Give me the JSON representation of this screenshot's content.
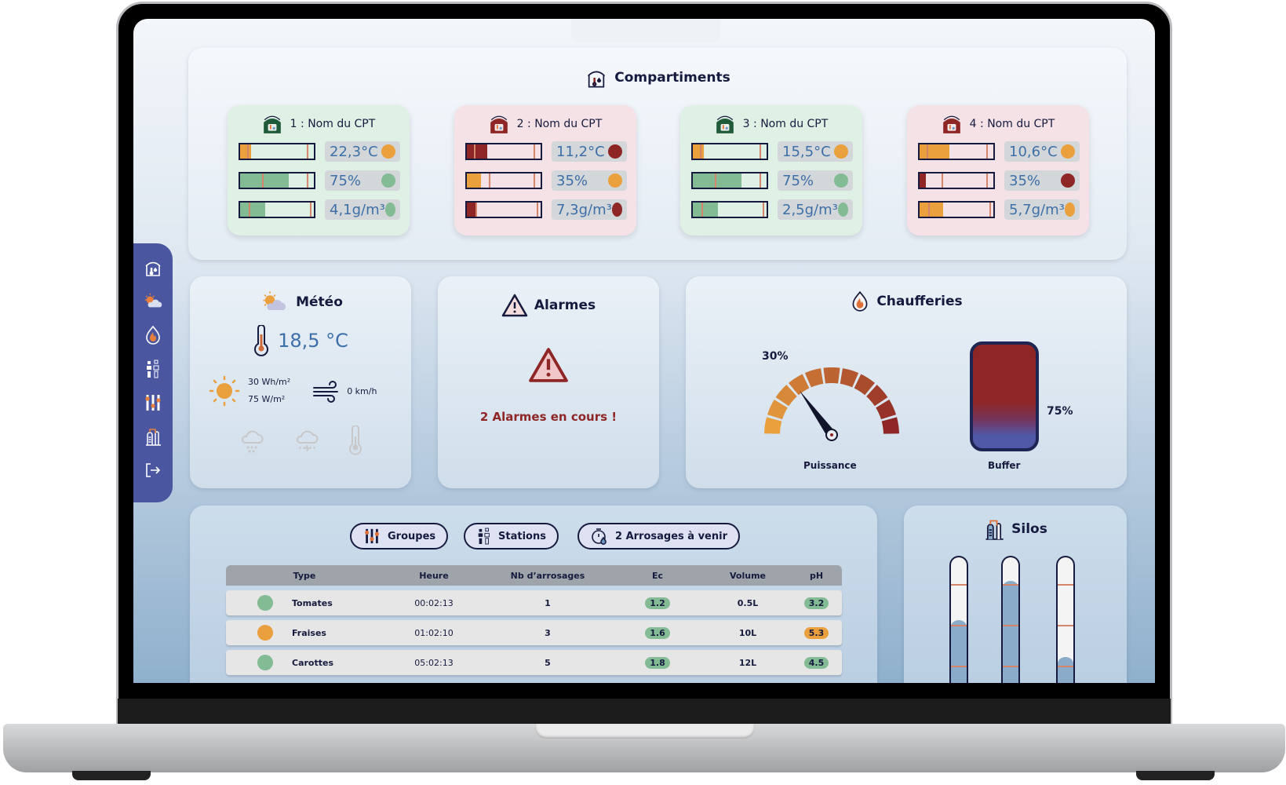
{
  "sidebar": {
    "items": [
      {
        "icon": "greenhouse-icon",
        "label": "Compartiments"
      },
      {
        "icon": "weather-icon",
        "label": "Météo"
      },
      {
        "icon": "flame-icon",
        "label": "Chaufferies"
      },
      {
        "icon": "stations-icon",
        "label": "Stations"
      },
      {
        "icon": "sliders-icon",
        "label": "Groupes"
      },
      {
        "icon": "silo-icon",
        "label": "Silos"
      },
      {
        "icon": "logout-icon",
        "label": "Déconnexion"
      }
    ]
  },
  "compartments": {
    "title": "Compartiments",
    "items": [
      {
        "name": "1 : Nom du CPT",
        "status": "ok",
        "metrics": [
          {
            "value": "22,3°C",
            "fill": 0.15,
            "fill_color": "#e9a03d",
            "status_color": "#e9a03d"
          },
          {
            "value": "75%",
            "fill": 0.66,
            "fill_color": "#82bb94",
            "status_color": "#82bb94"
          },
          {
            "value": "4,1g/m³",
            "fill": 0.34,
            "fill_color": "#82bb94",
            "status_color": "#82bb94"
          }
        ]
      },
      {
        "name": "2 : Nom du CPT",
        "status": "alarm",
        "metrics": [
          {
            "value": "11,2°C",
            "fill": 0.28,
            "fill_color": "#8e2626",
            "status_color": "#8e2626"
          },
          {
            "value": "35%",
            "fill": 0.19,
            "fill_color": "#e9a03d",
            "status_color": "#e9a03d"
          },
          {
            "value": "7,3g/m³",
            "fill": 0.13,
            "fill_color": "#8e2626",
            "status_color": "#8e2626"
          }
        ]
      },
      {
        "name": "3 : Nom du CPT",
        "status": "ok",
        "metrics": [
          {
            "value": "15,5°C",
            "fill": 0.15,
            "fill_color": "#e9a03d",
            "status_color": "#e9a03d"
          },
          {
            "value": "75%",
            "fill": 0.66,
            "fill_color": "#82bb94",
            "status_color": "#82bb94"
          },
          {
            "value": "2,5g/m³",
            "fill": 0.34,
            "fill_color": "#82bb94",
            "status_color": "#82bb94"
          }
        ]
      },
      {
        "name": "4 : Nom du CPT",
        "status": "alarm",
        "metrics": [
          {
            "value": "10,6°C",
            "fill": 0.4,
            "fill_color": "#e9a03d",
            "status_color": "#e9a03d"
          },
          {
            "value": "35%",
            "fill": 0.09,
            "fill_color": "#8e2626",
            "status_color": "#8e2626"
          },
          {
            "value": "5,7g/m³",
            "fill": 0.32,
            "fill_color": "#e9a03d",
            "status_color": "#e9a03d"
          }
        ]
      }
    ]
  },
  "weather": {
    "title": "Météo",
    "temperature": "18,5 °C",
    "radiation_energy": "30 Wh/m²",
    "radiation_power": "75 W/m²",
    "wind": "0 km/h"
  },
  "alarms": {
    "title": "Alarmes",
    "message": "2 Alarmes en cours !"
  },
  "boilers": {
    "title": "Chaufferies",
    "power_label": "Puissance",
    "power_value": "30%",
    "power_fraction": 0.3,
    "buffer_label": "Buffer",
    "buffer_value": "75%"
  },
  "irrigation": {
    "buttons": {
      "groups": "Groupes",
      "stations": "Stations",
      "upcoming": "2 Arrosages à venir"
    },
    "columns": [
      "Type",
      "Heure",
      "Nb d’arrosages",
      "Ec",
      "Volume",
      "pH"
    ],
    "rows": [
      {
        "color": "#82bb94",
        "type": "Tomates",
        "time": "00:02:13",
        "count": "1",
        "ec": "1.2",
        "ec_color": "#82bb94",
        "volume": "0.5L",
        "ph": "3.2",
        "ph_color": "#82bb94"
      },
      {
        "color": "#e9a03d",
        "type": "Fraises",
        "time": "01:02:10",
        "count": "3",
        "ec": "1.6",
        "ec_color": "#82bb94",
        "volume": "10L",
        "ph": "5.3",
        "ph_color": "#e9a03d"
      },
      {
        "color": "#82bb94",
        "type": "Carottes",
        "time": "05:02:13",
        "count": "5",
        "ec": "1.8",
        "ec_color": "#82bb94",
        "volume": "12L",
        "ph": "4.5",
        "ph_color": "#82bb94"
      }
    ]
  },
  "silos": {
    "title": "Silos",
    "levels": [
      0.5,
      0.78,
      0.24
    ]
  },
  "colors": {
    "accent": "#4a56a0",
    "navy": "#161a3e",
    "ok": "#82bb94",
    "warn": "#e9a03d",
    "alarm": "#8e2626",
    "value_text": "#3d6fa8"
  }
}
